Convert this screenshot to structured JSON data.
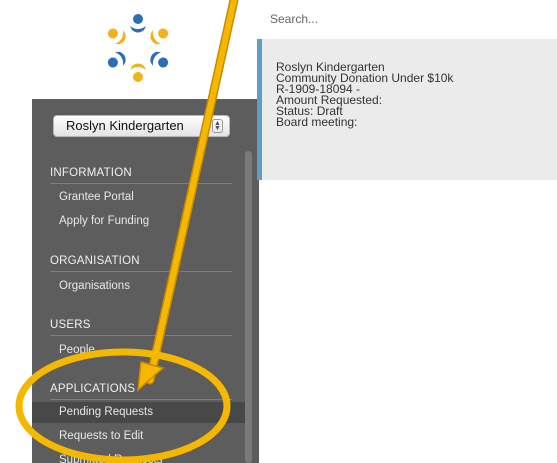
{
  "icons": {
    "logo": "circle-of-people-logo-icon",
    "select_chevron": "up-down-chevron-icon"
  },
  "colors": {
    "sidebar": "#5d5d5d",
    "card_accent": "#5e9dc6",
    "annotation": "#f5b800"
  },
  "sidebar": {
    "org_select": "Roslyn Kindergarten",
    "sections": [
      {
        "heading": "INFORMATION",
        "items": [
          "Grantee Portal",
          "Apply for Funding"
        ]
      },
      {
        "heading": "ORGANISATION",
        "items": [
          "Organisations"
        ]
      },
      {
        "heading": "USERS",
        "items": [
          "People"
        ]
      },
      {
        "heading": "APPLICATIONS",
        "items": [
          "Pending Requests",
          "Requests to Edit",
          "Submitted Requests"
        ]
      }
    ]
  },
  "search": {
    "placeholder": "Search..."
  },
  "request_card": {
    "organisation": "Roslyn Kindergarten",
    "fund": "Community Donation Under $10k",
    "reference": "R-1909-18094 -",
    "amount": "Amount Requested:",
    "status": "Status: Draft",
    "board": "Board meeting:"
  }
}
